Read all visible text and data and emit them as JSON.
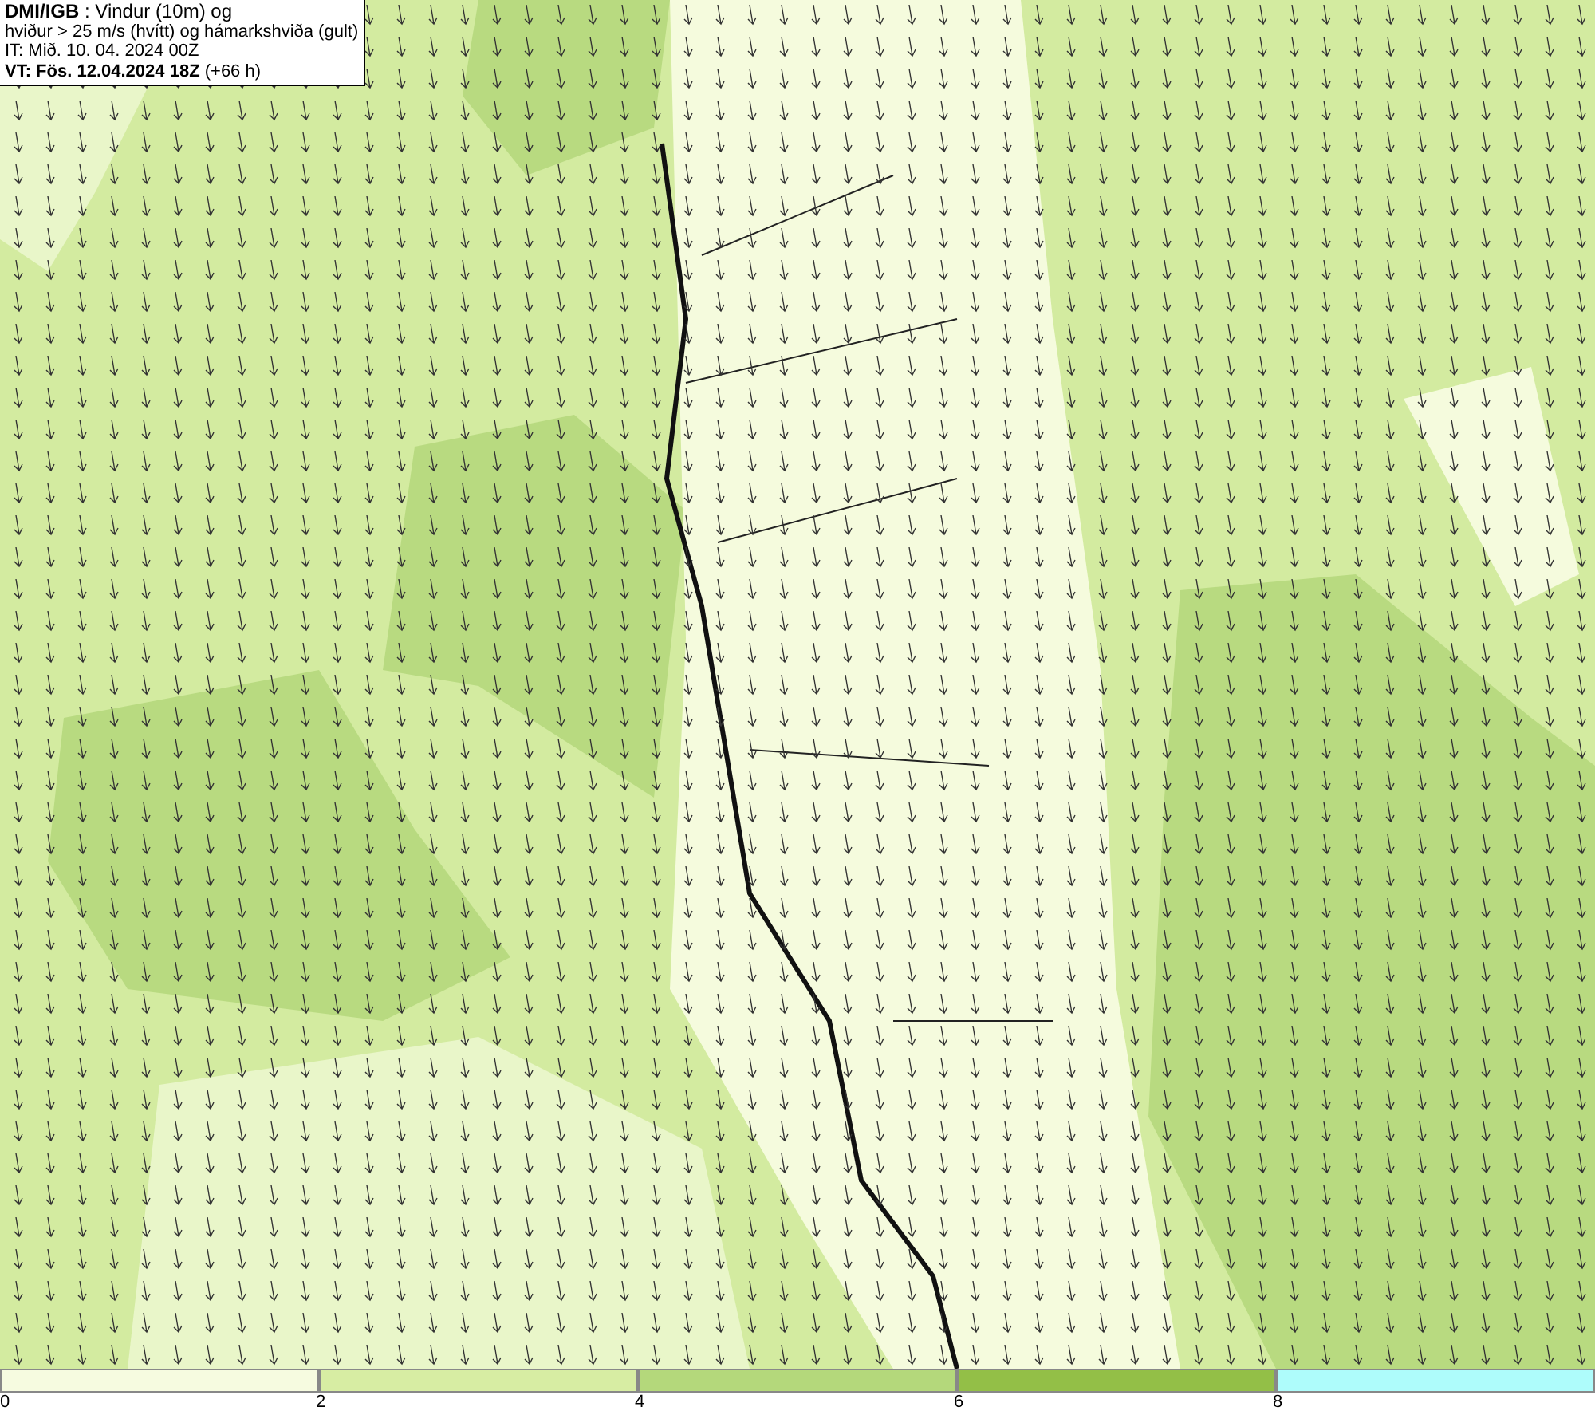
{
  "header": {
    "lines": [
      "**DMI/IGB** : Vindur (10m) og",
      "hviður > 25 m/s (hvítt) og hámarkshviða (gult)",
      "IT: Mið. 10. 04. 2024 00Z",
      "**VT: Fös. 12.04.2024 18Z** (+66 h)"
    ]
  },
  "legend": {
    "segments": [
      {
        "label": "0",
        "color": "#f6fbe0"
      },
      {
        "label": "2",
        "color": "#d7eda3"
      },
      {
        "label": "4",
        "color": "#b4d87b"
      },
      {
        "label": "6",
        "color": "#93bf47"
      },
      {
        "label": "8",
        "color": "#aefcfb"
      }
    ]
  }
}
